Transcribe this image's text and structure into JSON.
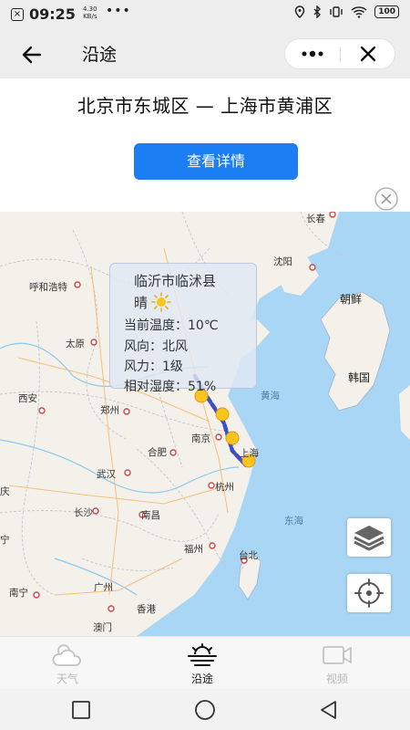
{
  "status_bar": {
    "time": "09:25",
    "net_speed_value": "4.30",
    "net_speed_unit": "KB/s",
    "more": "•••",
    "battery": "100"
  },
  "header": {
    "title": "沿途"
  },
  "route": {
    "title": "北京市东城区 — 上海市黄浦区",
    "detail_button": "查看详情"
  },
  "weather_popup": {
    "city": "临沂市临沭县",
    "condition": "晴",
    "temperature": "当前温度：10℃",
    "wind_direction": "风向：北风",
    "wind_force": "风力：1级",
    "humidity": "相对湿度：51%"
  },
  "map": {
    "cities": [
      "长春",
      "沈阳",
      "呼和浩特",
      "太原",
      "西安",
      "郑州",
      "南京",
      "合肥",
      "上海",
      "武汉",
      "杭州",
      "长沙",
      "南昌",
      "福州",
      "台北",
      "南宁",
      "广州",
      "香港",
      "澳门"
    ],
    "partial_cities": [
      "庆",
      "宁"
    ],
    "countries": [
      "朝鲜",
      "韩国"
    ],
    "seas": [
      "黄海",
      "东海"
    ],
    "controls": [
      "layers-icon",
      "locate-icon"
    ]
  },
  "tabs": [
    {
      "label": "天气",
      "icon": "cloud-icon",
      "active": false
    },
    {
      "label": "沿途",
      "icon": "sunrise-route-icon",
      "active": true
    },
    {
      "label": "视频",
      "icon": "video-icon",
      "active": false
    }
  ],
  "colors": {
    "accent": "#1b7ef2",
    "route_line": "#3f4fc0",
    "weather_dot": "#f7c420",
    "land": "#f4f1ea",
    "sea": "#a9d6f5"
  }
}
